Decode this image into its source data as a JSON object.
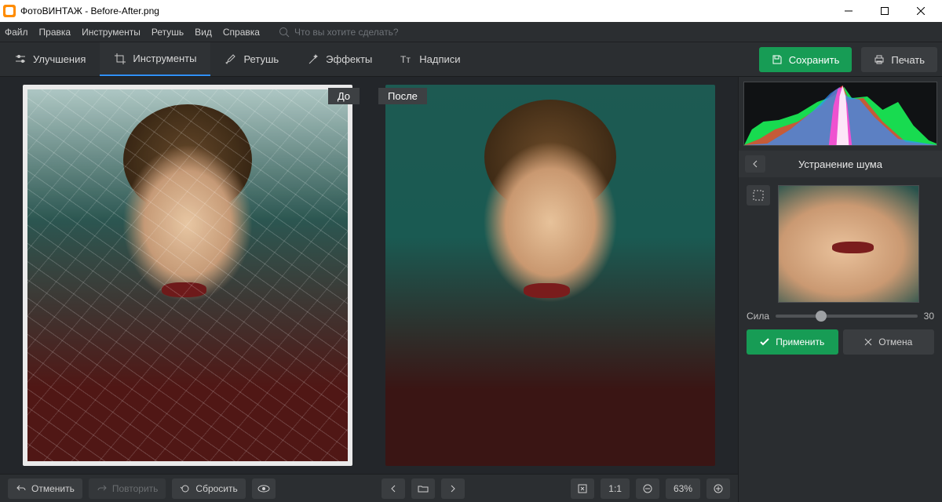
{
  "titlebar": {
    "title": "ФотоВИНТАЖ - Before-After.png"
  },
  "menu": {
    "file": "Файл",
    "edit": "Правка",
    "tools": "Инструменты",
    "retouch": "Ретушь",
    "view": "Вид",
    "help": "Справка",
    "search_placeholder": "Что вы хотите сделать?"
  },
  "toolbar": {
    "enhance": "Улучшения",
    "tools": "Инструменты",
    "retouch": "Ретушь",
    "effects": "Эффекты",
    "text": "Надписи",
    "save": "Сохранить",
    "print": "Печать"
  },
  "viewer": {
    "before_label": "До",
    "after_label": "После"
  },
  "footer": {
    "undo": "Отменить",
    "redo": "Повторить",
    "reset": "Сбросить",
    "fit": "1:1",
    "zoom_pct": "63%"
  },
  "panel": {
    "title": "Устранение шума",
    "strength_label": "Сила",
    "strength_value": "30",
    "apply": "Применить",
    "cancel": "Отмена"
  }
}
